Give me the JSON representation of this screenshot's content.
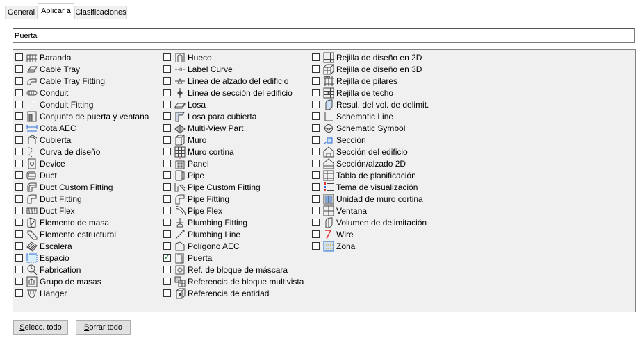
{
  "tabs": [
    "General",
    "Aplicar a",
    "Clasificaciones"
  ],
  "name_value": "Puerta",
  "columns": [
    [
      {
        "label": "Baranda",
        "icon": "railing-icon",
        "checked": false
      },
      {
        "label": "Cable Tray",
        "icon": "cable-tray-icon",
        "checked": false
      },
      {
        "label": "Cable Tray Fitting",
        "icon": "cable-tray-fitting-icon",
        "checked": false
      },
      {
        "label": "Conduit",
        "icon": "conduit-icon",
        "checked": false
      },
      {
        "label": "Conduit Fitting",
        "icon": "conduit-fitting-icon",
        "checked": false
      },
      {
        "label": "Conjunto de puerta y ventana",
        "icon": "door-window-assembly-icon",
        "checked": false
      },
      {
        "label": "Cota AEC",
        "icon": "aec-dimension-icon",
        "checked": false
      },
      {
        "label": "Cubierta",
        "icon": "roof-icon",
        "checked": false
      },
      {
        "label": "Curva de diseño",
        "icon": "layout-curve-icon",
        "checked": false
      },
      {
        "label": "Device",
        "icon": "device-icon",
        "checked": false
      },
      {
        "label": "Duct",
        "icon": "duct-icon",
        "checked": false
      },
      {
        "label": "Duct Custom Fitting",
        "icon": "duct-custom-fitting-icon",
        "checked": false
      },
      {
        "label": "Duct Fitting",
        "icon": "duct-fitting-icon",
        "checked": false
      },
      {
        "label": "Duct Flex",
        "icon": "duct-flex-icon",
        "checked": false
      },
      {
        "label": "Elemento de masa",
        "icon": "mass-element-icon",
        "checked": false
      },
      {
        "label": "Elemento estructural",
        "icon": "structural-member-icon",
        "checked": false
      },
      {
        "label": "Escalera",
        "icon": "stair-icon",
        "checked": false
      },
      {
        "label": "Espacio",
        "icon": "space-icon",
        "checked": false
      },
      {
        "label": "Fabrication",
        "icon": "fabrication-icon",
        "checked": false
      },
      {
        "label": "Grupo de masas",
        "icon": "mass-group-icon",
        "checked": false
      },
      {
        "label": "Hanger",
        "icon": "hanger-icon",
        "checked": false
      }
    ],
    [
      {
        "label": "Hueco",
        "icon": "opening-icon",
        "checked": false
      },
      {
        "label": "Label Curve",
        "icon": "label-curve-icon",
        "checked": false
      },
      {
        "label": "Línea de alzado del edificio",
        "icon": "elevation-line-icon",
        "checked": false
      },
      {
        "label": "Línea de sección del edificio",
        "icon": "section-line-icon",
        "checked": false
      },
      {
        "label": "Losa",
        "icon": "slab-icon",
        "checked": false
      },
      {
        "label": "Losa para cubierta",
        "icon": "roof-slab-icon",
        "checked": false
      },
      {
        "label": "Multi-View Part",
        "icon": "multi-view-part-icon",
        "checked": false
      },
      {
        "label": "Muro",
        "icon": "wall-icon",
        "checked": false
      },
      {
        "label": "Muro cortina",
        "icon": "curtain-wall-icon",
        "checked": false
      },
      {
        "label": "Panel",
        "icon": "panel-icon",
        "checked": false
      },
      {
        "label": "Pipe",
        "icon": "pipe-icon",
        "checked": false
      },
      {
        "label": "Pipe Custom Fitting",
        "icon": "pipe-custom-fitting-icon",
        "checked": false
      },
      {
        "label": "Pipe Fitting",
        "icon": "pipe-fitting-icon",
        "checked": false
      },
      {
        "label": "Pipe Flex",
        "icon": "pipe-flex-icon",
        "checked": false
      },
      {
        "label": "Plumbing Fitting",
        "icon": "plumbing-fitting-icon",
        "checked": false
      },
      {
        "label": "Plumbing Line",
        "icon": "plumbing-line-icon",
        "checked": false
      },
      {
        "label": "Polígono AEC",
        "icon": "aec-polygon-icon",
        "checked": false
      },
      {
        "label": "Puerta",
        "icon": "door-icon",
        "checked": true
      },
      {
        "label": "Ref. de bloque de máscara",
        "icon": "mask-block-ref-icon",
        "checked": false
      },
      {
        "label": "Referencia de bloque multivista",
        "icon": "multi-view-block-ref-icon",
        "checked": false
      },
      {
        "label": "Referencia de entidad",
        "icon": "entity-reference-icon",
        "checked": false
      }
    ],
    [
      {
        "label": "Rejilla de diseño en 2D",
        "icon": "layout-grid-2d-icon",
        "checked": false
      },
      {
        "label": "Rejilla de diseño en 3D",
        "icon": "layout-grid-3d-icon",
        "checked": false
      },
      {
        "label": "Rejilla de pilares",
        "icon": "column-grid-icon",
        "checked": false
      },
      {
        "label": "Rejilla de techo",
        "icon": "ceiling-grid-icon",
        "checked": false
      },
      {
        "label": "Resul. del vol. de delimit.",
        "icon": "bounding-volume-result-icon",
        "checked": false
      },
      {
        "label": "Schematic Line",
        "icon": "schematic-line-icon",
        "checked": false
      },
      {
        "label": "Schematic Symbol",
        "icon": "schematic-symbol-icon",
        "checked": false
      },
      {
        "label": "Sección",
        "icon": "section-icon",
        "checked": false
      },
      {
        "label": "Sección del edificio",
        "icon": "building-section-icon",
        "checked": false
      },
      {
        "label": "Sección/alzado 2D",
        "icon": "section-elevation-2d-icon",
        "checked": false
      },
      {
        "label": "Tabla de planificación",
        "icon": "schedule-table-icon",
        "checked": false
      },
      {
        "label": "Tema de visualización",
        "icon": "display-theme-icon",
        "checked": false
      },
      {
        "label": "Unidad de muro cortina",
        "icon": "curtain-wall-unit-icon",
        "checked": false
      },
      {
        "label": "Ventana",
        "icon": "window-icon",
        "checked": false
      },
      {
        "label": "Volumen de delimitación",
        "icon": "bounding-volume-icon",
        "checked": false
      },
      {
        "label": "Wire",
        "icon": "wire-icon",
        "checked": false
      },
      {
        "label": "Zona",
        "icon": "zone-icon",
        "checked": false
      }
    ]
  ],
  "buttons": {
    "select_all": "Selecc. todo",
    "clear_all": "Borrar todo"
  },
  "colors": {
    "check": "#217a3c",
    "icon_stroke": "#444444",
    "accent_blue": "#2a6fd6"
  }
}
